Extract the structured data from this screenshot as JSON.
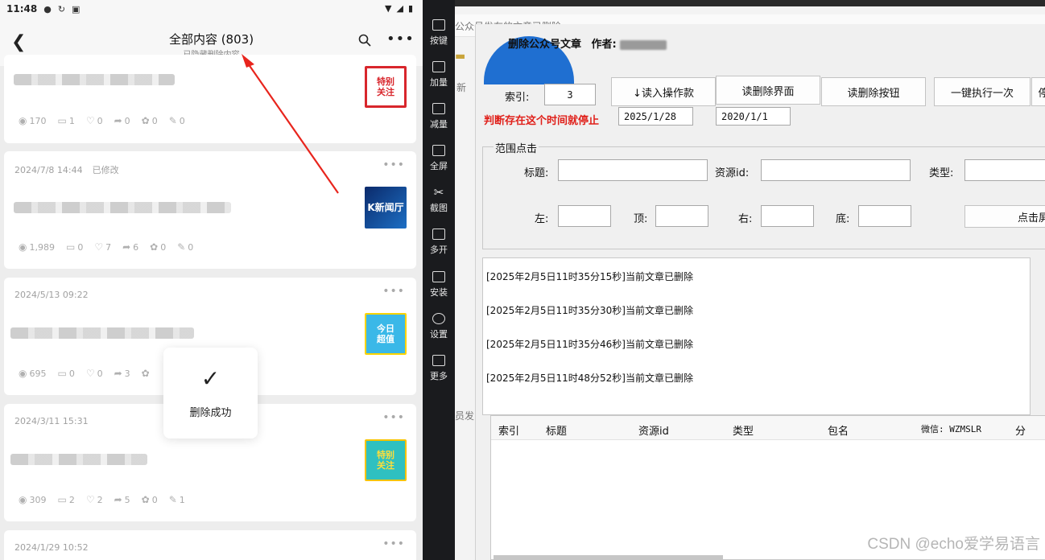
{
  "phone": {
    "status": {
      "time": "11:48"
    },
    "appbar": {
      "title": "全部内容 (803)",
      "subtitle": "已隐藏删除内容"
    },
    "cards": [
      {
        "date": "",
        "modified": "",
        "thumb": "特别\n关注",
        "stats": {
          "views": "170",
          "comments": "1",
          "likes": "0",
          "shares": "0",
          "gifts": "0",
          "edits": "0"
        }
      },
      {
        "date": "2024/7/8 14:44",
        "modified": "已修改",
        "thumb": "K新闻厅",
        "stats": {
          "views": "1,989",
          "comments": "0",
          "likes": "7",
          "shares": "6",
          "gifts": "0",
          "edits": "0"
        }
      },
      {
        "date": "2024/5/13 09:22",
        "modified": "",
        "thumb": "今日\n超值",
        "stats": {
          "views": "695",
          "comments": "0",
          "likes": "0",
          "shares": "3",
          "gifts": "",
          "edits": ""
        }
      },
      {
        "date": "2024/3/11 15:31",
        "modified": "",
        "thumb": "特别\n关注",
        "stats": {
          "views": "309",
          "comments": "2",
          "likes": "2",
          "shares": "5",
          "gifts": "0",
          "edits": "1"
        }
      },
      {
        "date": "2024/1/29 10:52",
        "modified": ""
      }
    ],
    "toast": {
      "message": "删除成功"
    }
  },
  "sidebar": {
    "items": [
      {
        "label": "按键",
        "icon": "keyboard-icon"
      },
      {
        "label": "加量",
        "icon": "volume-up-icon"
      },
      {
        "label": "减量",
        "icon": "volume-down-icon"
      },
      {
        "label": "全屏",
        "icon": "fullscreen-icon"
      },
      {
        "label": "截图",
        "icon": "scissors-icon"
      },
      {
        "label": "多开",
        "icon": "multi-open-icon"
      },
      {
        "label": "安装",
        "icon": "apk-install-icon"
      },
      {
        "label": "设置",
        "icon": "settings-icon"
      },
      {
        "label": "更多",
        "icon": "more-icon"
      }
    ]
  },
  "behind": {
    "fragment_top": "公众号发布的文章已删除",
    "fragment_left1": "新",
    "fragment_left2": "员发"
  },
  "dialog": {
    "title": "删除公众号文章",
    "author_label": "作者:",
    "index_label": "索引:",
    "index_value": "3",
    "buttons": {
      "read_ops": "↓读入操作款",
      "read_delete_page": "读删除界面",
      "read_delete_btn": "读删除按钮",
      "run_once": "一键执行一次",
      "more": "停"
    },
    "warning": "判断存在这个时间就停止",
    "date1": "2025/1/28",
    "date2": "2020/1/1",
    "range": {
      "legend": "范围点击",
      "title_label": "标题:",
      "resource_label": "资源id:",
      "type_label": "类型:",
      "left_label": "左:",
      "top_label": "顶:",
      "right_label": "右:",
      "bottom_label": "底:",
      "click_button": "点击屏"
    },
    "log": [
      "[2025年2月5日11时35分15秒]当前文章已删除",
      "[2025年2月5日11时35分30秒]当前文章已删除",
      "[2025年2月5日11时35分46秒]当前文章已删除",
      "[2025年2月5日11时48分52秒]当前文章已删除"
    ],
    "table_headers": [
      "索引",
      "标题",
      "资源id",
      "类型",
      "包名",
      "微信: WZMSLR",
      "分"
    ]
  },
  "watermark": "CSDN @echo爱学易语言",
  "colors": {
    "accent_red": "#e0201a",
    "logo_blue": "#1f6fd1",
    "sidebar_bg": "#1a1b1e"
  }
}
